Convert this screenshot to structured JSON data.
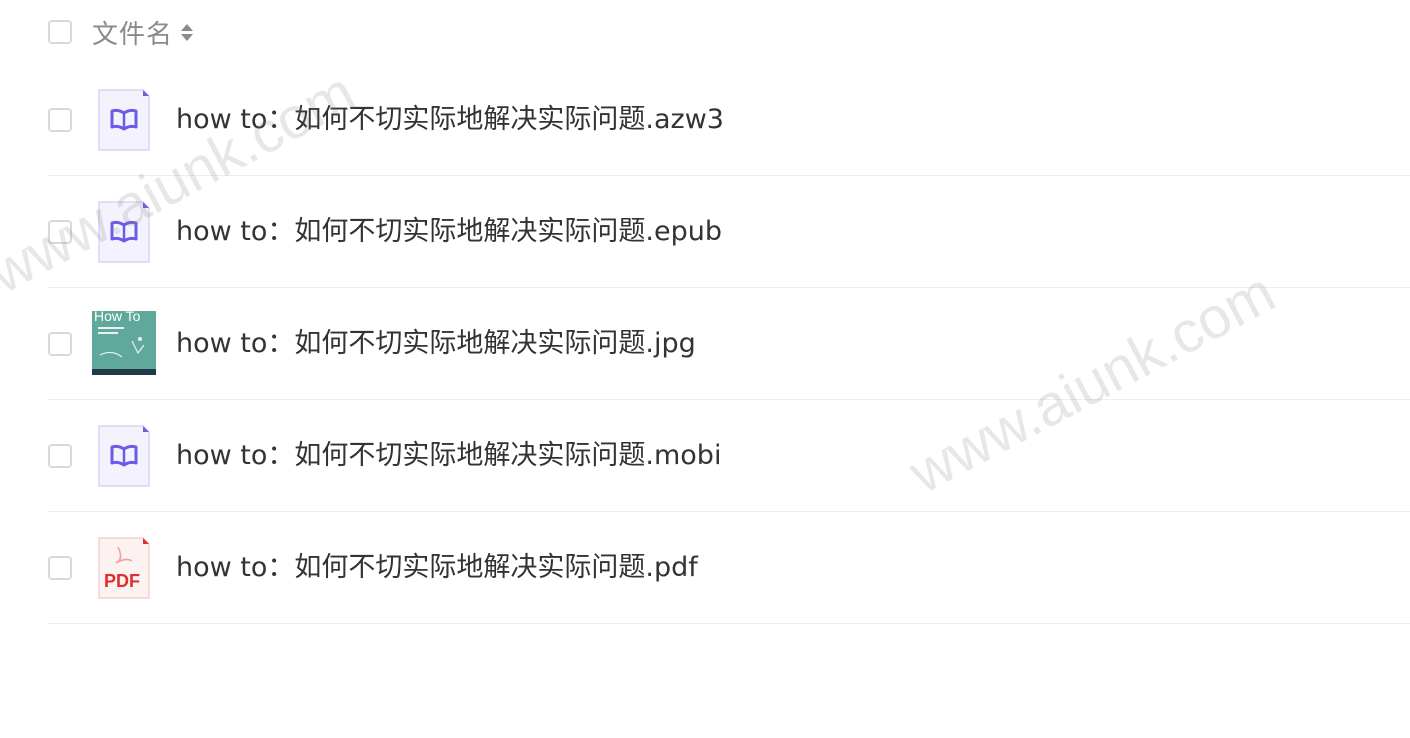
{
  "header": {
    "label": "文件名"
  },
  "files": [
    {
      "name": "how to：如何不切实际地解决实际问题.azw3",
      "icon": "ebook-icon"
    },
    {
      "name": "how to：如何不切实际地解决实际问题.epub",
      "icon": "ebook-icon"
    },
    {
      "name": "how to：如何不切实际地解决实际问题.jpg",
      "icon": "image-thumbnail",
      "thumb_text": "How To"
    },
    {
      "name": "how to：如何不切实际地解决实际问题.mobi",
      "icon": "ebook-icon"
    },
    {
      "name": "how to：如何不切实际地解决实际问题.pdf",
      "icon": "pdf-icon",
      "icon_text": "PDF"
    }
  ],
  "watermark": "www.aiunk.com",
  "colors": {
    "ebook_accent": "#6b5ce7",
    "pdf_accent": "#e02e2e",
    "thumb_bg": "#5fa89b"
  }
}
